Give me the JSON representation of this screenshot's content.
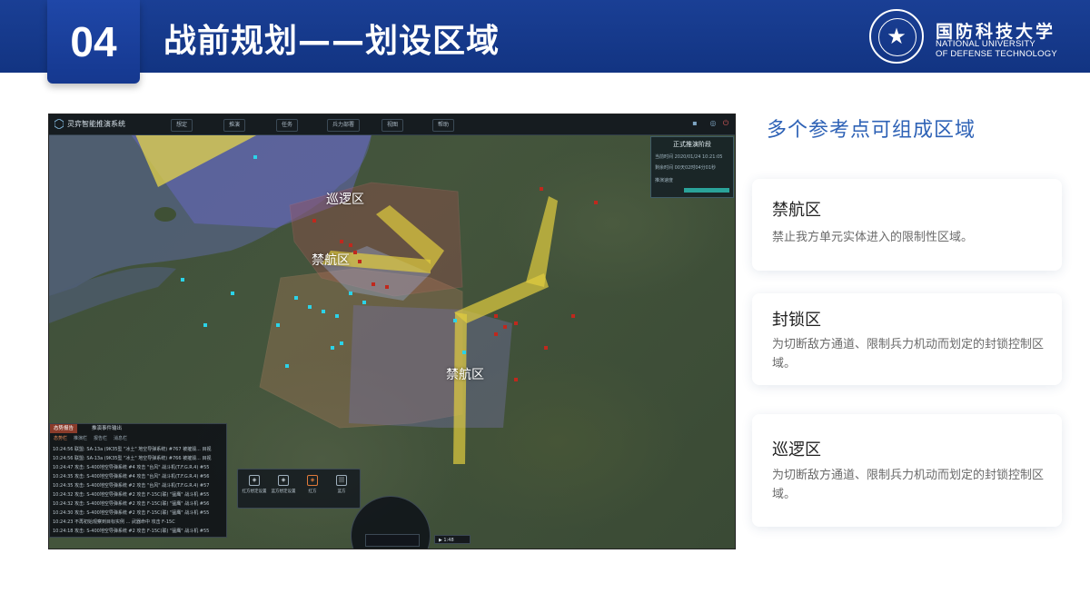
{
  "header": {
    "number": "04",
    "title": "战前规划——划设区域",
    "logo": {
      "name_cn": "国防科技大学",
      "name_en_line1": "NATIONAL UNIVERSITY",
      "name_en_line2": "OF DEFENSE TECHNOLOGY"
    }
  },
  "screenshot": {
    "app_title": "灵弈智能推演系统",
    "toolbar": [
      "想定",
      "推演",
      "任务",
      "兵力部署",
      "视图",
      "帮助"
    ],
    "zone_labels": [
      "巡逻区",
      "禁航区",
      "禁航区"
    ],
    "stage_panel": {
      "title": "正式推演阶段",
      "rows": [
        "当前时间  2020/01/24 10:21:05",
        "剩余时间  00天02时04分01秒",
        "推演速度"
      ]
    },
    "log_panel": {
      "tabs": [
        "态势报告",
        "推演事件输出"
      ],
      "subtabs": [
        "态势栏",
        "推演栏",
        "报告栏",
        "消息栏"
      ],
      "lines": [
        "10:24:56 联盟: SA-13a (9K35型 \"冰土\" 地空导弹系统) #767 被摧毁... 目视",
        "10:24:56 联盟: SA-13a (9K35型 \"冰土\" 地空导弹系统) #766 被摧毁... 目视",
        "10:24:47 攻击: S-400地空导弹系统 #4 攻击 \"台风\" 战斗机(T.F.G.R.4) #55",
        "10:24:35 攻击: S-400地空导弹系统 #4 攻击 \"台风\" 战斗机(T.F.G.R.4) #56",
        "10:24:35 攻击: S-400地空导弹系统 #2 攻击 \"台风\" 战斗机(T.F.G.R.4) #57",
        "10:24:32 攻击: S-400地空导弹系统 #2 攻击 F-15C(联) \"猛鹰\" 战斗机 #55",
        "10:24:32 攻击: S-400地空导弹系统 #2 攻击 F-15C(联) \"猛鹰\" 战斗机 #56",
        "10:24:30 攻击: S-400地空导弹系统 #2 攻击 F-15C(联) \"猛鹰\" 战斗机 #55",
        "10:24:23 不再初始观察到目标实例 ... 武器命中 攻击 F-15C",
        "10:24:18 攻击: S-400地空导弹系统 #2 攻击 F-15C(联) \"猛鹰\" 战斗机 #55"
      ]
    },
    "controls": [
      "红方想定设置",
      "蓝方想定设置",
      "红方",
      "蓝方"
    ],
    "play_time": "▶ 1:48"
  },
  "right": {
    "subtitle": "多个参考点可组成区域",
    "cards": [
      {
        "title": "禁航区",
        "desc": "禁止我方单元实体进入的限制性区域。"
      },
      {
        "title": "封锁区",
        "desc": "为切断敌方通道、限制兵力机动而划定的封锁控制区域。"
      },
      {
        "title": "巡逻区",
        "desc": "为切断敌方通道、限制兵力机动而划定的封锁控制区域。"
      }
    ]
  }
}
